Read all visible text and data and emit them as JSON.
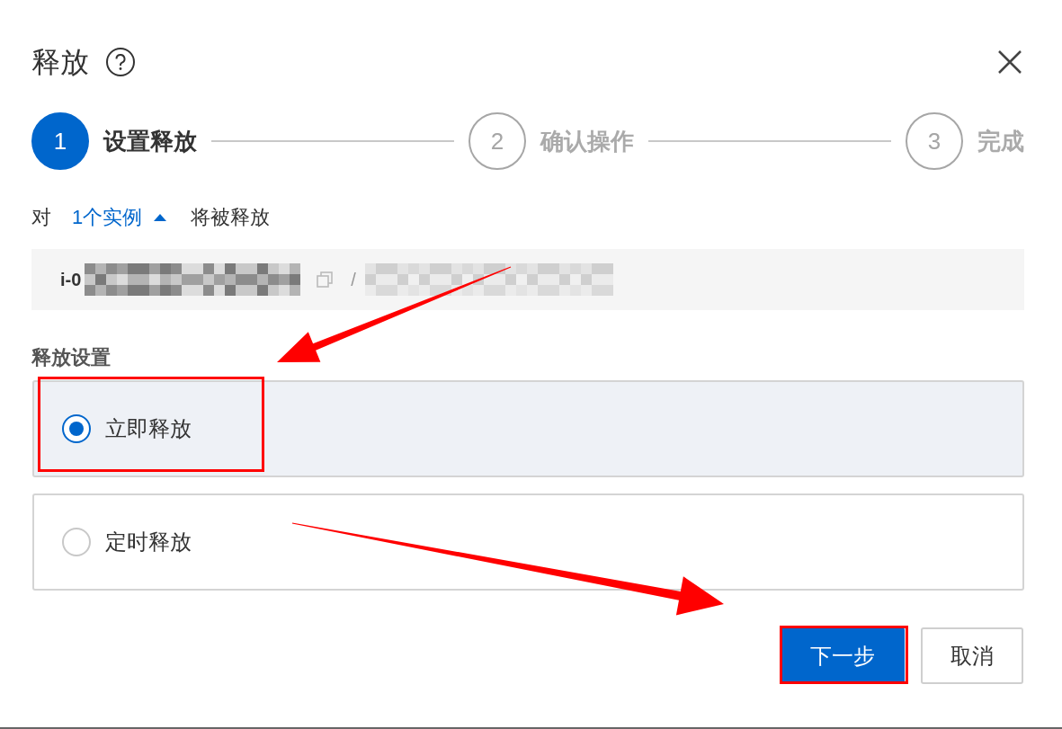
{
  "dialog": {
    "title": "释放"
  },
  "steps": [
    {
      "number": "1",
      "label": "设置释放",
      "selected": true
    },
    {
      "number": "2",
      "label": "确认操作",
      "selected": false
    },
    {
      "number": "3",
      "label": "完成",
      "selected": false
    }
  ],
  "target": {
    "prefix": "对",
    "link": "1个实例",
    "expanded": true,
    "suffix": "将被释放"
  },
  "instances": [
    {
      "id": "i-0",
      "separator": "/"
    }
  ],
  "release_settings": {
    "label": "释放设置",
    "options": [
      {
        "label": "立即释放",
        "selected": true
      },
      {
        "label": "定时释放",
        "selected": false
      }
    ]
  },
  "buttons": [
    {
      "label": "下一步",
      "kind": "primary"
    },
    {
      "label": "取消",
      "kind": "default"
    }
  ]
}
